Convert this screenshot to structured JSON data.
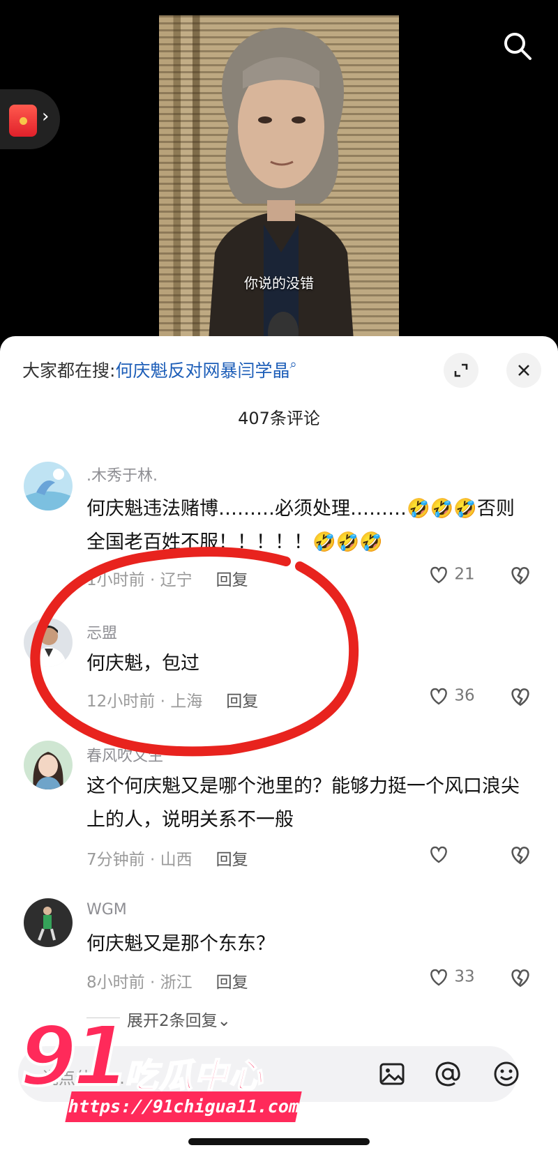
{
  "video": {
    "subtitle": "你说的没错"
  },
  "search_bar": {
    "prefix": "大家都在搜:",
    "keyword": "何庆魁反对网暴闫学晶",
    "search_glyph": "⌕"
  },
  "comments_header": {
    "count_label": "407条评论"
  },
  "comments": [
    {
      "name": ".木秀于林.",
      "text": "何庆魁违法赌博………必须处理………🤣🤣🤣否则全国老百姓不服！！！！！🤣🤣🤣",
      "time": "1小时前 · 辽宁",
      "reply": "回复",
      "likes": "21"
    },
    {
      "name": "忈盟",
      "text": "何庆魁，包过",
      "time": "12小时前 · 上海",
      "reply": "回复",
      "likes": "36"
    },
    {
      "name": "春风吹又生",
      "text": "这个何庆魁又是哪个池里的？能够力挺一个风口浪尖上的人，说明关系不一般",
      "time": "7分钟前 · 山西",
      "reply": "回复",
      "likes": ""
    },
    {
      "name": "WGM",
      "text": "何庆魁又是那个东东？",
      "time": "8小时前 · 浙江",
      "reply": "回复",
      "likes": "33"
    }
  ],
  "expand_replies": "展开2条回复⌄",
  "input": {
    "placeholder": "说点什么..."
  },
  "watermark": {
    "big": "91",
    "cn": "吃瓜中心",
    "url": "https://91chigua11.com"
  },
  "colors": {
    "accent_link": "#1d5eb8",
    "watermark": "#ff2a5a",
    "annotation_circle": "#e8231e"
  },
  "icons": [
    "search-icon",
    "red-packet-icon",
    "expand-icon",
    "close-icon",
    "heart-icon",
    "broken-heart-icon",
    "image-icon",
    "at-icon",
    "emoji-icon"
  ]
}
